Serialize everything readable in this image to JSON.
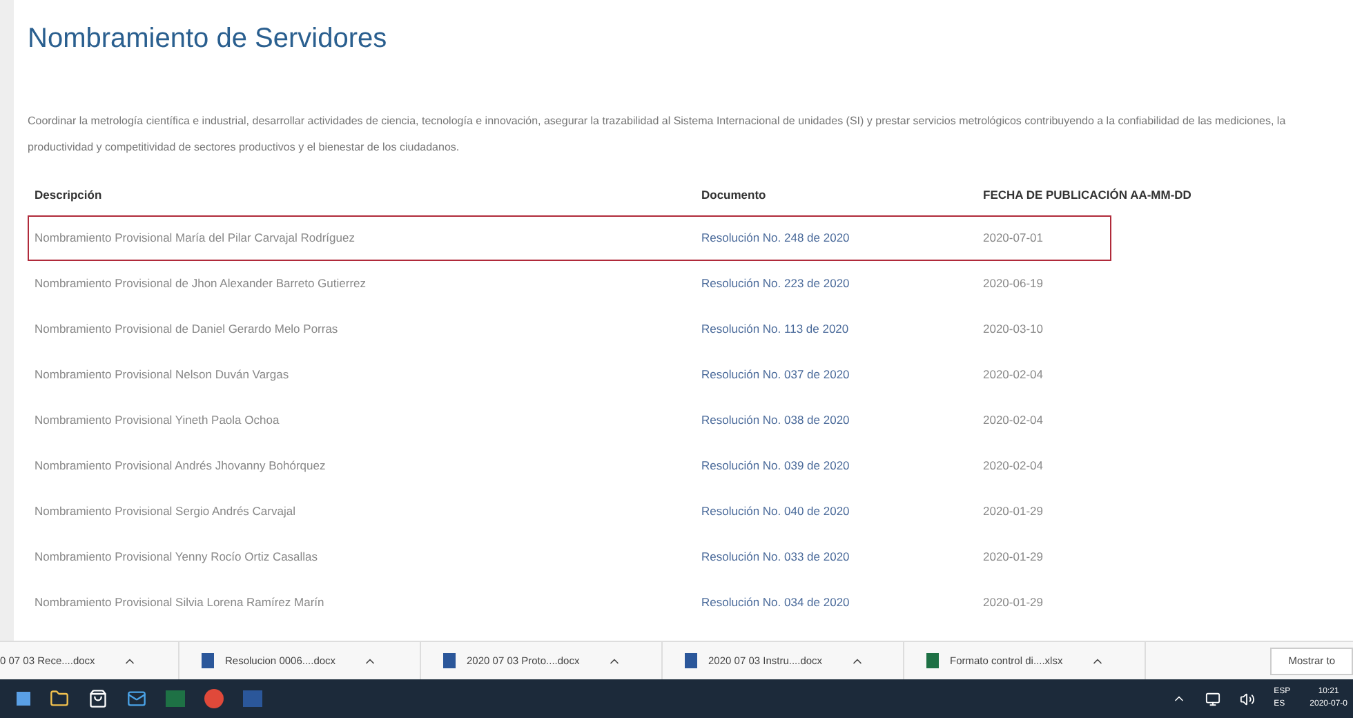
{
  "page": {
    "title": "Nombramiento de Servidores",
    "intro": "Coordinar la metrología científica e industrial, desarrollar actividades de ciencia, tecnología e innovación, asegurar la trazabilidad al Sistema Internacional de unidades (SI) y prestar servicios metrológicos contribuyendo a la confiabilidad de las mediciones, la productividad y competitividad de sectores productivos y el bienestar de los ciudadanos."
  },
  "table": {
    "columns": [
      "Descripción",
      "Documento",
      "FECHA DE PUBLICACIÓN  AA-MM-DD"
    ],
    "rows": [
      {
        "description": "Nombramiento Provisional María del Pilar Carvajal Rodríguez",
        "document": "Resolución No. 248 de 2020",
        "date": "2020-07-01",
        "selected": true
      },
      {
        "description": "Nombramiento Provisional de Jhon Alexander Barreto Gutierrez",
        "document": "Resolución No. 223 de 2020",
        "date": "2020-06-19",
        "selected": false
      },
      {
        "description": "Nombramiento Provisional de Daniel Gerardo Melo Porras",
        "document": "Resolución No. 113 de 2020",
        "date": "2020-03-10",
        "selected": false
      },
      {
        "description": "Nombramiento Provisional Nelson Duván Vargas",
        "document": "Resolución No. 037 de 2020",
        "date": "2020-02-04",
        "selected": false
      },
      {
        "description": "Nombramiento Provisional Yineth Paola Ochoa",
        "document": "Resolución No. 038 de 2020",
        "date": "2020-02-04",
        "selected": false
      },
      {
        "description": "Nombramiento Provisional Andrés Jhovanny Bohórquez",
        "document": "Resolución No. 039 de 2020",
        "date": "2020-02-04",
        "selected": false
      },
      {
        "description": "Nombramiento Provisional Sergio Andrés Carvajal",
        "document": "Resolución No. 040 de 2020",
        "date": "2020-01-29",
        "selected": false
      },
      {
        "description": "Nombramiento Provisional Yenny Rocío Ortiz Casallas",
        "document": "Resolución No. 033 de 2020",
        "date": "2020-01-29",
        "selected": false
      },
      {
        "description": "Nombramiento Provisional Silvia Lorena Ramírez Marín",
        "document": "Resolución No. 034 de 2020",
        "date": "2020-01-29",
        "selected": false
      }
    ]
  },
  "downloads": {
    "items": [
      {
        "name": "0 07 03 Rece....docx"
      },
      {
        "name": "Resolucion 0006....docx",
        "kind": "doc"
      },
      {
        "name": "2020 07 03 Proto....docx",
        "kind": "doc"
      },
      {
        "name": "2020 07 03 Instru....docx",
        "kind": "doc"
      },
      {
        "name": "Formato control di....xlsx",
        "kind": "xls"
      }
    ],
    "show_all": "Mostrar to"
  },
  "taskbar": {
    "language": "ESP",
    "layout": "ES",
    "time": "10:21",
    "date": "2020-07-0"
  }
}
